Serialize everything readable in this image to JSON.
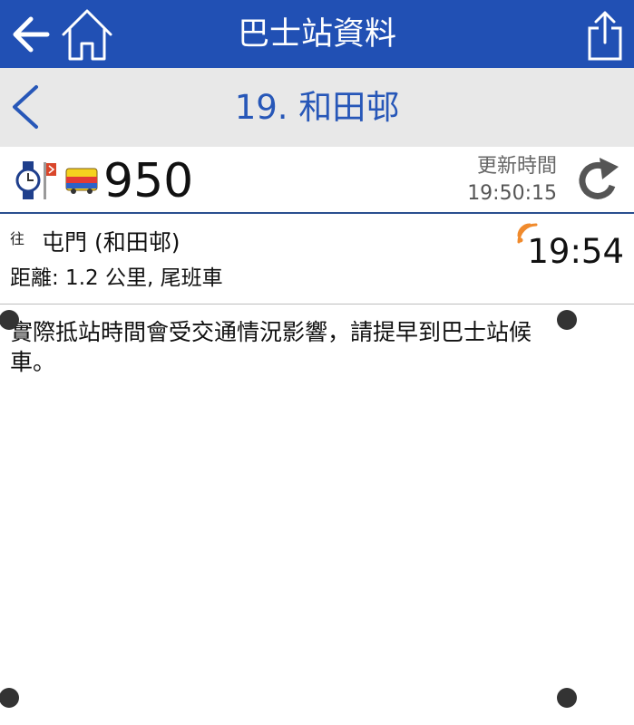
{
  "header": {
    "title": "巴士站資料",
    "back_icon": "arrow-left-icon",
    "home_icon": "home-icon",
    "share_icon": "share-icon",
    "bg_color": "#2150b4"
  },
  "stop": {
    "title": "19. 和田邨",
    "prev_icon": "chevron-left-icon"
  },
  "route": {
    "number": "950",
    "update_label": "更新時間",
    "update_time": "19:50:15",
    "icons": [
      "watch-icon",
      "bus-stop-flag-icon",
      "bus-icon",
      "refresh-icon"
    ]
  },
  "eta": {
    "to_label": "往",
    "destination": "屯門 (和田邨)",
    "distance": "距離: 1.2 公里, 尾班車",
    "time": "19:54",
    "realtime_icon": "realtime-signal-icon",
    "accent": "#f08a2c"
  },
  "notice": {
    "text": "實際抵站時間會受交通情況影響，請提早到巴士站候車。"
  }
}
